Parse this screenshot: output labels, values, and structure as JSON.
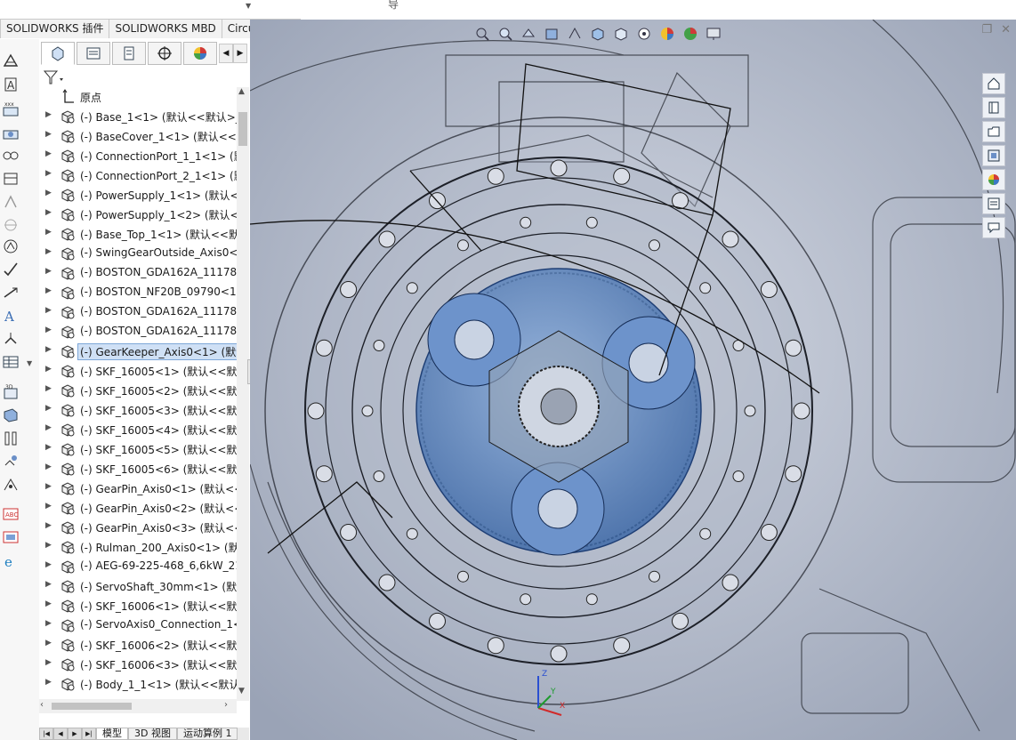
{
  "top_tabs": [
    "SOLIDWORKS 插件",
    "SOLIDWORKS MBD",
    "CircuitWorks"
  ],
  "top_partial_char": "导",
  "fm_tabs": [
    "feature-manager-tree-icon",
    "property-manager-icon",
    "configuration-manager-icon",
    "dim-xpert-icon",
    "display-manager-icon"
  ],
  "tree": {
    "origin": "原点",
    "selected_index": 13,
    "items": [
      "(-) Base_1<1> (默认<<默认>_显",
      "(-) BaseCover_1<1> (默认<<默",
      "(-) ConnectionPort_1_1<1> (默",
      "(-) ConnectionPort_2_1<1> (默",
      "(-) PowerSupply_1<1> (默认<<",
      "(-) PowerSupply_1<2> (默认<<",
      "(-) Base_Top_1<1> (默认<<默",
      "(-) SwingGearOutside_Axis0<1",
      "(-) BOSTON_GDA162A_11178<",
      "(-) BOSTON_NF20B_09790<1>",
      "(-) BOSTON_GDA162A_11178<",
      "(-) BOSTON_GDA162A_11178<",
      "(-) GearKeeper_Axis0<1> (默认",
      "(-) SKF_16005<1> (默认<<默认",
      "(-) SKF_16005<2> (默认<<默认",
      "(-) SKF_16005<3> (默认<<默认",
      "(-) SKF_16005<4> (默认<<默认",
      "(-) SKF_16005<5> (默认<<默认",
      "(-) SKF_16005<6> (默认<<默认",
      "(-) GearPin_Axis0<1> (默认<<",
      "(-) GearPin_Axis0<2> (默认<<",
      "(-) GearPin_Axis0<3> (默认<<",
      "(-) Rulman_200_Axis0<1> (默认",
      "(-) AEG-69-225-468_6,6kW_21",
      "(-) ServoShaft_30mm<1> (默认",
      "(-) SKF_16006<1> (默认<<默认",
      "(-) ServoAxis0_Connection_1<",
      "(-) SKF_16006<2> (默认<<默认",
      "(-) SKF_16006<3> (默认<<默认",
      "(-) Body_1_1<1> (默认<<默认"
    ]
  },
  "bottom_tabs": [
    "模型",
    "3D 视图",
    "运动算例 1"
  ],
  "triad_labels": {
    "x": "X",
    "y": "Y",
    "z": "Z"
  },
  "colors": {
    "selection": "#cfe0f5",
    "viewport_bg": "#b7bfcf",
    "highlight_blue": "#5b84c4"
  }
}
